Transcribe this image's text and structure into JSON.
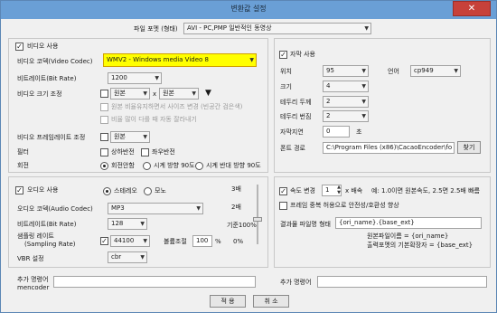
{
  "title": "변환값 설정",
  "close_label": "✕",
  "file_format": {
    "label": "파일 포멧 (형태)",
    "value": "AVI - PC,PMP 일반적인 동영상"
  },
  "video": {
    "use_label": "비디오 사용",
    "codec_label": "비디오 코덱(Video Codec)",
    "codec_value": "WMV2 - Windows media Video 8",
    "bitrate_label": "비트레이트(Bit Rate)",
    "bitrate_value": "1200",
    "size_label": "비디오 크기 조정",
    "width_value": "원본",
    "x_sep": "x",
    "height_value": "원본",
    "keep_ratio_label": "원본 비율유지하면서 사이즈 변경 (빈공간 검은색)",
    "crop_label": "비율 많이 다를 때 자동 잘라내기",
    "framerate_label": "비디오 프레임레이트 조정",
    "framerate_value": "원본",
    "filter_label": "필터",
    "flip_v_label": "상하반전",
    "flip_h_label": "좌우반전",
    "rotate_label": "회전",
    "rotate_none": "회전안함",
    "rotate_cw": "시계 방향 90도",
    "rotate_ccw": "시계 반대 방향 90도"
  },
  "subtitle": {
    "use_label": "자막 사용",
    "position_label": "위치",
    "position_value": "95",
    "lang_label": "언어",
    "lang_value": "cp949",
    "size_label": "크기",
    "size_value": "4",
    "border_label": "테두리 두께",
    "border_value": "2",
    "blur_label": "테두리 번짐",
    "blur_value": "2",
    "delay_label": "자막지연",
    "delay_value": "0",
    "delay_unit": "초",
    "font_path_label": "폰트 경로",
    "font_path_value": "C:\\Program Files (x86)\\CacaoEncoder\\fo",
    "browse_label": "찾기"
  },
  "audio": {
    "use_label": "오디오 사용",
    "stereo_label": "스테레오",
    "mono_label": "모노",
    "codec_label": "오디오 코덱(Audio Codec)",
    "codec_value": "MP3",
    "bitrate_label": "비트레이트(Bit Rate)",
    "bitrate_value": "128",
    "samplerate_label_1": "샘플링 레이트",
    "samplerate_label_2": "(Sampling Rate)",
    "samplerate_value": "44100",
    "volume_label": "볼륨조절",
    "volume_value": "100",
    "volume_unit": "%",
    "vbr_label": "VBR 설정",
    "vbr_value": "cbr",
    "slider_top": "3배",
    "slider_mid": "2배",
    "slider_default": "기준100%",
    "slider_bottom": "0%",
    "slider_fraction": 0.58
  },
  "speed": {
    "change_label": "속도 변경",
    "value": "1",
    "multiplier_text": "x 배속",
    "desc": "예: 1.0이면 원본속도, 2.5면 2.5배 빠름",
    "frame_label": "프레임 중복 허용으로 안전성/호환성 향상"
  },
  "output": {
    "name_label": "결과물 파일명 형태",
    "name_value": "{ori_name}.{base_ext}",
    "hint1": "원본파일이름 = {ori_name}",
    "hint2": "출력포멧의 기본확장자 = {base_ext}"
  },
  "extra": {
    "mencoder_label_1": "추가 명령어",
    "mencoder_label_2": "mencoder",
    "cmd_label": "추가 명령어"
  },
  "buttons": {
    "apply": "적 용",
    "cancel": "취 소"
  }
}
